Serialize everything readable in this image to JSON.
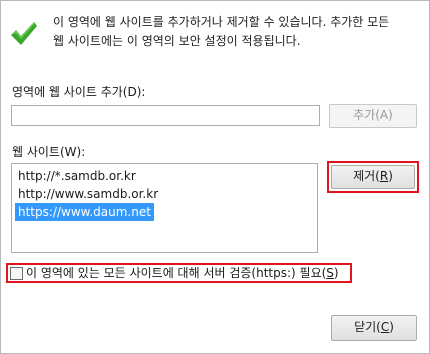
{
  "info": {
    "line1": "이 영역에 웹 사이트를 추가하거나 제거할 수 있습니다. 추가한 모든",
    "line2": "웹 사이트에는 이 영역의 보안 설정이 적용됩니다."
  },
  "add_site": {
    "label": "영역에 웹 사이트 추가(D):",
    "input_value": "",
    "button_label": "추가(A)"
  },
  "sites": {
    "label": "웹 사이트(W):",
    "items": [
      {
        "text": "http://*.samdb.or.kr",
        "selected": false
      },
      {
        "text": "http://www.samdb.or.kr",
        "selected": false
      },
      {
        "text": "https://www.daum.net",
        "selected": true
      }
    ],
    "remove_label_pre": "제거(",
    "remove_mnemonic": "R",
    "remove_label_post": ")"
  },
  "https_check": {
    "label_pre": "이 영역에 있는 모든 사이트에 대해 서버 검증(https:) 필요(",
    "mnemonic": "S",
    "label_post": ")",
    "checked": false
  },
  "close": {
    "label_pre": "닫기(",
    "mnemonic": "C",
    "label_post": ")"
  },
  "colors": {
    "check": "#3aa82a",
    "highlight": "#e2141e",
    "selection": "#3399ff"
  },
  "icons": {
    "info": "checkmark-icon"
  }
}
